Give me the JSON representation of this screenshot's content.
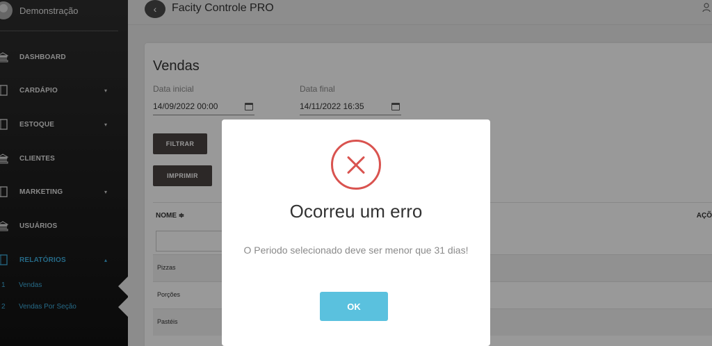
{
  "sidebar": {
    "user_name": "Demonstração",
    "items": [
      {
        "label": "DASHBOARD",
        "icon": "bank-icon",
        "caret": ""
      },
      {
        "label": "CARDÁPIO",
        "icon": "book-icon",
        "caret": "▾"
      },
      {
        "label": "ESTOQUE",
        "icon": "book-icon",
        "caret": "▾"
      },
      {
        "label": "CLIENTES",
        "icon": "bank-icon",
        "caret": ""
      },
      {
        "label": "MARKETING",
        "icon": "book-icon",
        "caret": "▾"
      },
      {
        "label": "USUÁRIOS",
        "icon": "bank-icon",
        "caret": ""
      },
      {
        "label": "RELATÓRIOS",
        "icon": "book-icon",
        "caret": "▴"
      }
    ],
    "subitems": [
      {
        "num": "1",
        "label": "Vendas"
      },
      {
        "num": "2",
        "label": "Vendas Por Seção"
      }
    ]
  },
  "topbar": {
    "back_icon": "‹",
    "title": "Facity Controle PRO",
    "user_icon": "user-icon"
  },
  "main": {
    "title": "Vendas",
    "start_label": "Data inicial",
    "start_value": "14/09/2022 00:00",
    "end_label": "Data final",
    "end_value": "14/11/2022 16:35",
    "filter_button": "FILTRAR",
    "print_button": "IMPRIMIR",
    "columns": {
      "name": "NOME ≑",
      "actions": "AÇÕ"
    },
    "rows": [
      "Pizzas",
      "Porções",
      "Pastéis"
    ]
  },
  "modal": {
    "title": "Ocorreu um erro",
    "message": "O Periodo selecionado deve ser menor que 31 dias!",
    "ok_label": "OK",
    "icon": "error-x-icon"
  },
  "colors": {
    "accent": "#3fb0e0",
    "error": "#d9534f",
    "ok_button": "#5ac1de",
    "dark_button": "#4a4341"
  }
}
